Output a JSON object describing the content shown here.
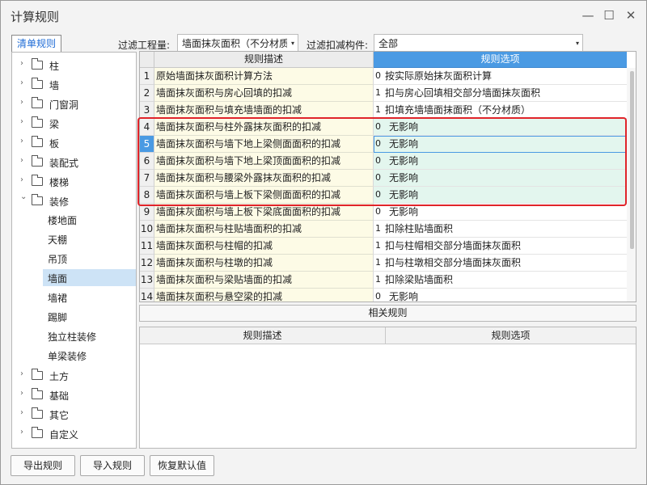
{
  "window": {
    "title": "计算规则"
  },
  "titlebar": {
    "minimize": "—",
    "maximize": "☐",
    "close": "✕"
  },
  "tabs": {
    "active": "清单规则"
  },
  "filters": {
    "project_label": "过滤工程量:",
    "project_value": "墙面抹灰面积（不分材质）",
    "deduct_label": "过滤扣减构件:",
    "deduct_value": "全部"
  },
  "tree": {
    "items": [
      {
        "label": "柱",
        "expanded": false
      },
      {
        "label": "墙",
        "expanded": false
      },
      {
        "label": "门窗洞",
        "expanded": false
      },
      {
        "label": "梁",
        "expanded": false
      },
      {
        "label": "板",
        "expanded": false
      },
      {
        "label": "装配式",
        "expanded": false
      },
      {
        "label": "楼梯",
        "expanded": false
      },
      {
        "label": "装修",
        "expanded": true
      }
    ],
    "children": [
      "楼地面",
      "天棚",
      "吊顶",
      "墙面",
      "墙裙",
      "踢脚",
      "独立柱装修",
      "单梁装修"
    ],
    "selected_child": "墙面",
    "after": [
      {
        "label": "土方"
      },
      {
        "label": "基础"
      },
      {
        "label": "其它"
      },
      {
        "label": "自定义"
      }
    ],
    "collapsed_glyph": "›",
    "expanded_glyph": "⌄"
  },
  "grid": {
    "col_desc": "规则描述",
    "col_opt": "规则选项",
    "rows": [
      {
        "num": "1",
        "desc": "原始墙面抹灰面积计算方法",
        "code": "0",
        "opt": "按实际原始抹灰面积计算"
      },
      {
        "num": "2",
        "desc": "墙面抹灰面积与房心回填的扣减",
        "code": "1",
        "opt": "扣与房心回填相交部分墙面抹灰面积"
      },
      {
        "num": "3",
        "desc": "墙面抹灰面积与填充墙墙面的扣减",
        "code": "1",
        "opt": "扣填充墙墙面抹面积（不分材质）"
      },
      {
        "num": "4",
        "desc": "墙面抹灰面积与柱外露抹灰面积的扣减",
        "code": "0",
        "opt": "无影响"
      },
      {
        "num": "5",
        "desc": "墙面抹灰面积与墙下地上梁侧面面积的扣减",
        "code": "0",
        "opt": "无影响"
      },
      {
        "num": "6",
        "desc": "墙面抹灰面积与墙下地上梁顶面面积的扣减",
        "code": "0",
        "opt": "无影响"
      },
      {
        "num": "7",
        "desc": "墙面抹灰面积与腰梁外露抹灰面积的扣减",
        "code": "0",
        "opt": "无影响"
      },
      {
        "num": "8",
        "desc": "墙面抹灰面积与墙上板下梁侧面面积的扣减",
        "code": "0",
        "opt": "无影响"
      },
      {
        "num": "9",
        "desc": "墙面抹灰面积与墙上板下梁底面面积的扣减",
        "code": "0",
        "opt": "无影响"
      },
      {
        "num": "10",
        "desc": "墙面抹灰面积与柱贴墙面积的扣减",
        "code": "1",
        "opt": "扣除柱贴墙面积"
      },
      {
        "num": "11",
        "desc": "墙面抹灰面积与柱帽的扣减",
        "code": "1",
        "opt": "扣与柱帽相交部分墙面抹灰面积"
      },
      {
        "num": "12",
        "desc": "墙面抹灰面积与柱墩的扣减",
        "code": "1",
        "opt": "扣与柱墩相交部分墙面抹灰面积"
      },
      {
        "num": "13",
        "desc": "墙面抹灰面积与梁贴墙面的扣减",
        "code": "1",
        "opt": "扣除梁贴墙面积"
      },
      {
        "num": "14",
        "desc": "墙面抹灰面积与悬空梁的扣减",
        "code": "0",
        "opt": "无影响"
      }
    ],
    "highlighted_rows": [
      "4",
      "5",
      "6",
      "7",
      "8"
    ],
    "selected_row": "5"
  },
  "related": {
    "title": "相关规则",
    "col_desc": "规则描述",
    "col_opt": "规则选项"
  },
  "buttons": {
    "export": "导出规则",
    "import": "导入规则",
    "restore": "恢复默认值"
  },
  "colors": {
    "accent": "#4a9ae3",
    "highlight_border": "#e0242a",
    "highlight_fill": "#e3f6ee",
    "desc_fill": "#fdfbe6"
  }
}
